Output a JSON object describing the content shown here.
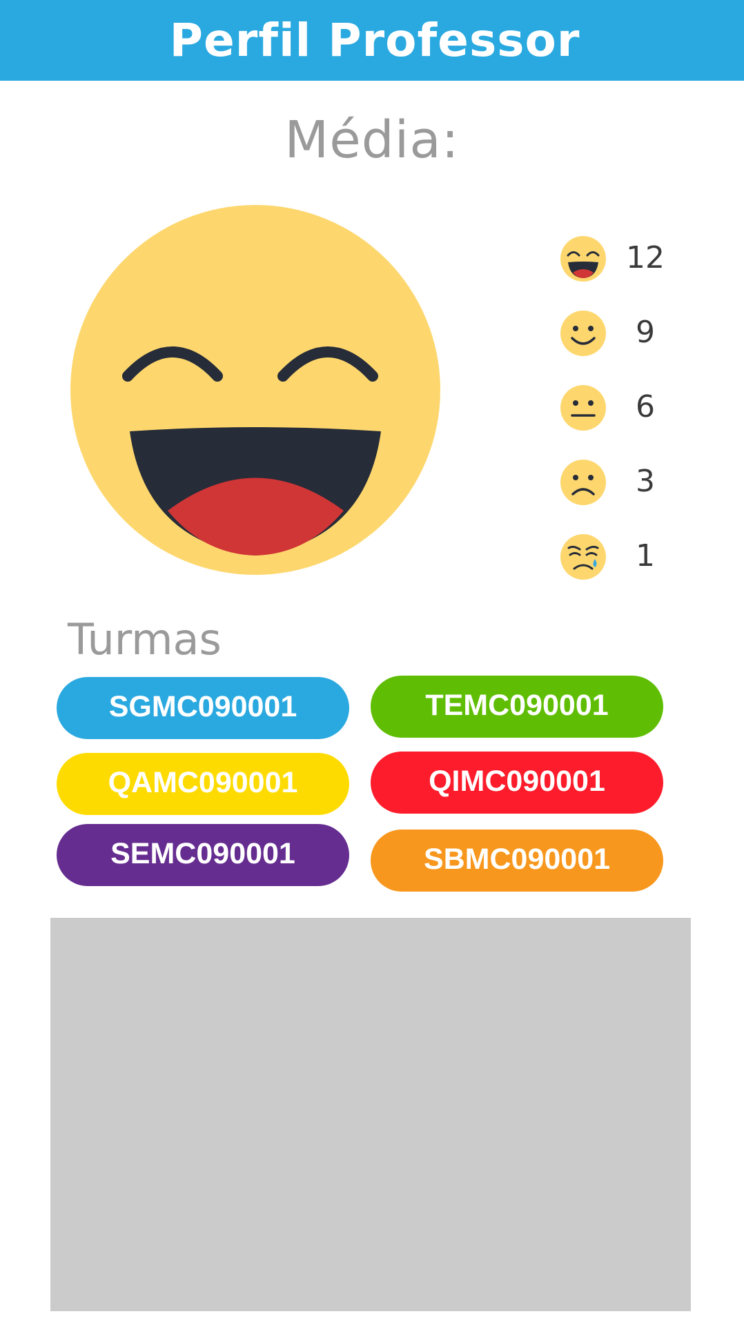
{
  "header": {
    "title": "Perfil Professor"
  },
  "media": {
    "label": "Média:",
    "current_icon": "laughing-face"
  },
  "ratings": [
    {
      "icon": "laughing-face",
      "count": "12"
    },
    {
      "icon": "smiling-face",
      "count": "9"
    },
    {
      "icon": "neutral-face",
      "count": "6"
    },
    {
      "icon": "frowning-face",
      "count": "3"
    },
    {
      "icon": "crying-face",
      "count": "1"
    }
  ],
  "turmas": {
    "label": "Turmas",
    "classes": [
      {
        "code": "SGMC090001",
        "color": "#2aa9e0"
      },
      {
        "code": "TEMC090001",
        "color": "#5fbe04"
      },
      {
        "code": "QAMC090001",
        "color": "#fedb00"
      },
      {
        "code": "QIMC090001",
        "color": "#fd1c2b"
      },
      {
        "code": "SEMC090001",
        "color": "#662d91"
      },
      {
        "code": "SBMC090001",
        "color": "#f8971d"
      }
    ]
  },
  "colors": {
    "accent": "#2aa9e0",
    "emoji_face": "#fdd76e",
    "emoji_dark": "#262c38",
    "emoji_tongue": "#d03636",
    "placeholder": "#cbcbcb"
  }
}
